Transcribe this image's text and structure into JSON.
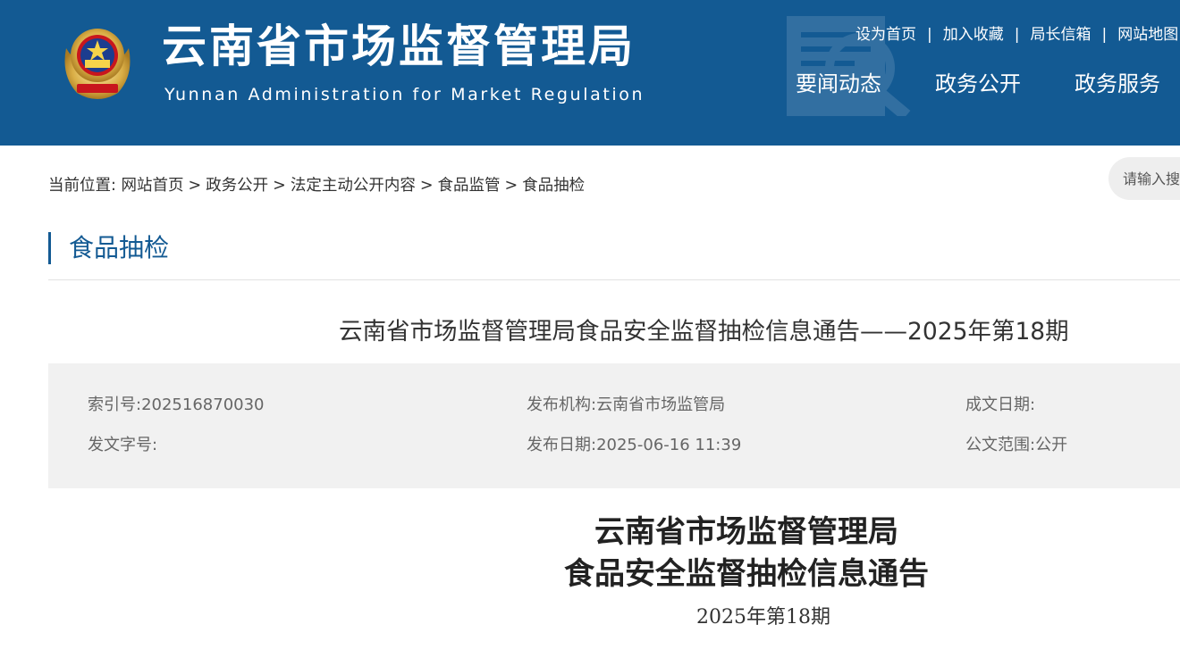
{
  "header": {
    "title": "云南省市场监督管理局",
    "subtitle": "Yunnan Administration for Market Regulation",
    "colors": {
      "brand": "#135a93",
      "text": "#ffffff"
    },
    "emblem_icon": "national-emblem-icon",
    "top_links": [
      "设为首页",
      "加入收藏",
      "局长信箱",
      "网站地图"
    ],
    "top_separator": "|",
    "nav": [
      "要闻动态",
      "政务公开",
      "政务服务"
    ]
  },
  "breadcrumb": {
    "prefix": "当前位置:",
    "items": [
      "网站首页",
      "政务公开",
      "法定主动公开内容",
      "食品监管",
      "食品抽检"
    ],
    "separator": ">"
  },
  "search": {
    "placeholder": "请输入搜索内容"
  },
  "section": {
    "title": "食品抽检"
  },
  "document": {
    "title": "云南省市场监督管理局食品安全监督抽检信息通告——2025年第18期",
    "meta": {
      "index_label": "索引号:",
      "index_value": "202516870030",
      "org_label": "发布机构:",
      "org_value": "云南省市场监管局",
      "date_made_label": "成文日期:",
      "date_made_value": "",
      "doc_no_label": "发文字号:",
      "doc_no_value": "",
      "pub_date_label": "发布日期:",
      "pub_date_value": "2025-06-16 11:39",
      "scope_label": "公文范围:",
      "scope_value": "公开"
    }
  },
  "article": {
    "heading_line1": "云南省市场监督管理局",
    "heading_line2": "食品安全监督抽检信息通告",
    "issue": "2025年第18期"
  }
}
